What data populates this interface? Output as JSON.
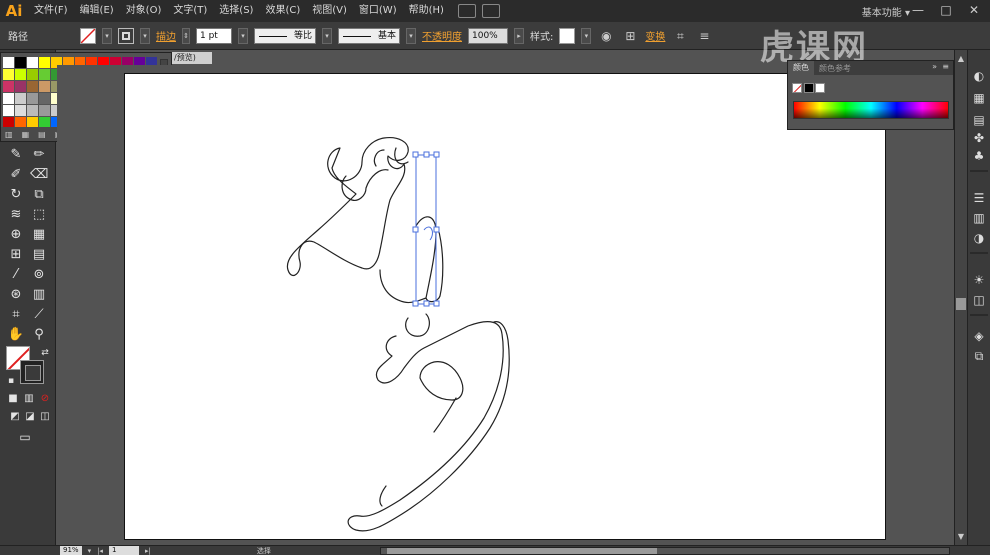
{
  "app": {
    "logo": "Ai",
    "workspace": "基本功能",
    "workspace_arrow": "▾",
    "search_icon": "search-icon"
  },
  "menu": [
    "文件(F)",
    "编辑(E)",
    "对象(O)",
    "文字(T)",
    "选择(S)",
    "效果(C)",
    "视图(V)",
    "窗口(W)",
    "帮助(H)"
  ],
  "window_controls": {
    "minimize": "—",
    "maximize": "□",
    "close": "✕"
  },
  "control_bar": {
    "object_type": "路径",
    "stroke_link": "描边",
    "stroke_weight": "1 pt",
    "profile_label": "等比",
    "brush_label": "基本",
    "opacity_link": "不透明度",
    "opacity_value": "100%",
    "style_label": "样式:",
    "transform_link": "变换"
  },
  "document_tab": {
    "label": "/预览)"
  },
  "watermark": "虎课网",
  "color_panel": {
    "tab_color": "颜色",
    "tab_guide": "颜色参考",
    "menu_icon": "»",
    "close_icon": "≡"
  },
  "swatches": {
    "rows": [
      [
        "#ffffff",
        "#000000",
        "#ffffff",
        "#ffff00",
        "#ffcc00",
        "#ff9900",
        "#ff6600",
        "#ff3300",
        "#ff0000",
        "#cc0033",
        "#990066",
        "#660099",
        "#333399"
      ],
      [
        "#ffff33",
        "#ccff00",
        "#99cc00",
        "#66cc33",
        "#339933",
        "#009966",
        "#00cccc",
        "#0099cc",
        "#0066cc",
        "#3333cc",
        "#6633cc",
        "#9933cc",
        "#cc33cc"
      ],
      [
        "#cc3366",
        "#993366",
        "#996633",
        "#cc9966",
        "#999966",
        "#666633",
        "#999999",
        "#cccccc",
        "#996699",
        "#663366",
        "#666666",
        "#333333"
      ],
      [
        "#ffffff",
        "#cccccc",
        "#999999",
        "#666666",
        "#ffffcc",
        "#cccc99",
        "#999933",
        "#888866",
        "#cccccc",
        "#aaaaaa",
        "#888888"
      ],
      [
        "#ffffff",
        "#dddddd",
        "#bbbbbb",
        "#999999",
        "#cccccc",
        "#aaaaaa",
        "#ffffff",
        "#eeeeee",
        "#dddddd",
        "#cccccc"
      ],
      [
        "#cc0000",
        "#ff6600",
        "#ffcc00",
        "#33cc33",
        "#0066ff",
        "#6633cc",
        "#cc3399"
      ]
    ]
  },
  "status_bar": {
    "zoom": "91%",
    "page": "1",
    "tool_status": "选择"
  },
  "colors": {
    "accent": "#f7a21b",
    "link": "#f0a030",
    "selection": "#4a6fdc",
    "artboard": "#ffffff"
  }
}
